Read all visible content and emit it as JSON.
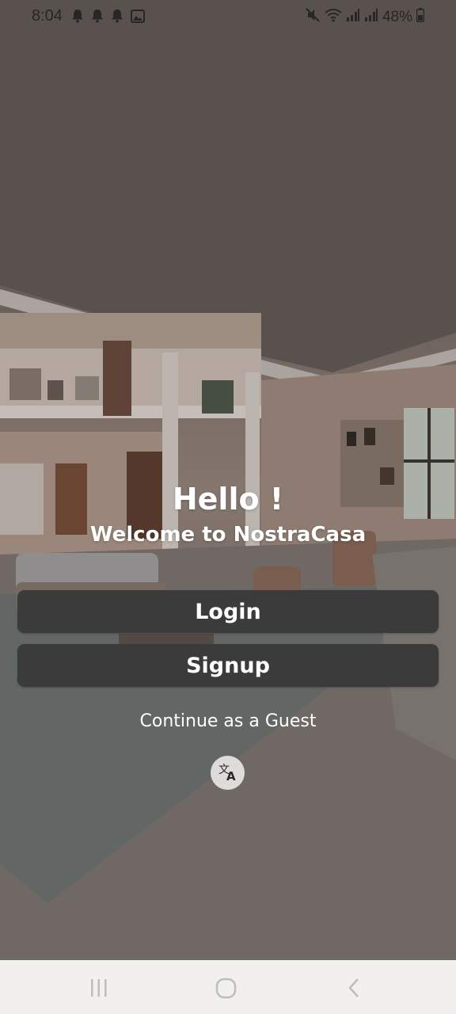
{
  "status_bar": {
    "time": "8:04",
    "battery": "48%",
    "icons": [
      "bell-icon",
      "bell-icon",
      "bell-icon",
      "image-icon",
      "mute-icon",
      "wifi-icon",
      "signal-icon",
      "signal-icon",
      "battery-icon"
    ]
  },
  "content": {
    "hello": "Hello !",
    "welcome": "Welcome to NostraCasa",
    "login_label": "Login",
    "signup_label": "Signup",
    "guest_label": "Continue as a Guest",
    "language_icon": "translate-icon"
  },
  "nav_bar": {
    "icons": [
      "recents-icon",
      "home-icon",
      "back-icon"
    ]
  },
  "colors": {
    "button_bg": "#3b3b3b",
    "text": "#ffffff",
    "nav_bg": "#f1f0ef"
  }
}
